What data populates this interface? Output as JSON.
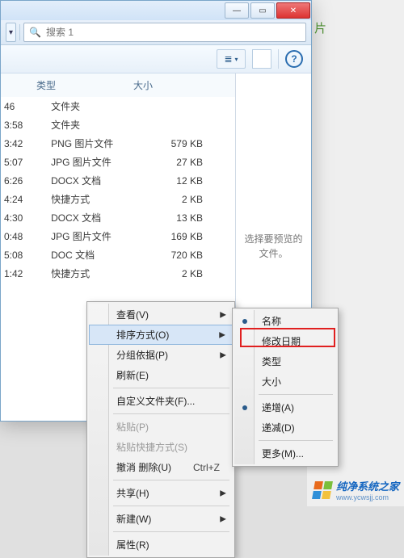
{
  "colors": {
    "accent": "#2a6db0",
    "danger": "#d33434",
    "highlight": "#e02020"
  },
  "titlebar": {
    "minimize": "—",
    "maximize": "▭",
    "close": "✕"
  },
  "corner_char": "片",
  "toolbar": {
    "nav_dropdown": "▾",
    "search_label": "搜索 1",
    "view_icon": "≣",
    "view_chevron": "▾",
    "preview_box": "□",
    "help": "?"
  },
  "columns": {
    "type": "类型",
    "size": "大小"
  },
  "rows": [
    {
      "time": "46",
      "type": "文件夹",
      "size": ""
    },
    {
      "time": "3:58",
      "type": "文件夹",
      "size": ""
    },
    {
      "time": "3:42",
      "type": "PNG 图片文件",
      "size": "579 KB"
    },
    {
      "time": "5:07",
      "type": "JPG 图片文件",
      "size": "27 KB"
    },
    {
      "time": "6:26",
      "type": "DOCX 文档",
      "size": "12 KB"
    },
    {
      "time": "4:24",
      "type": "快捷方式",
      "size": "2 KB"
    },
    {
      "time": "4:30",
      "type": "DOCX 文档",
      "size": "13 KB"
    },
    {
      "time": "0:48",
      "type": "JPG 图片文件",
      "size": "169 KB"
    },
    {
      "time": "5:08",
      "type": "DOC 文档",
      "size": "720 KB"
    },
    {
      "time": "1:42",
      "type": "快捷方式",
      "size": "2 KB"
    }
  ],
  "preview_text": "选择要预览的文件。",
  "context_menu": {
    "items": [
      {
        "label": "查看(V)",
        "submenu": true
      },
      {
        "label": "排序方式(O)",
        "submenu": true,
        "hover": true
      },
      {
        "label": "分组依据(P)",
        "submenu": true
      },
      {
        "label": "刷新(E)"
      },
      {
        "sep": true
      },
      {
        "label": "自定义文件夹(F)..."
      },
      {
        "sep": true
      },
      {
        "label": "粘贴(P)",
        "disabled": true
      },
      {
        "label": "粘贴快捷方式(S)",
        "disabled": true
      },
      {
        "label": "撤消 删除(U)",
        "shortcut": "Ctrl+Z"
      },
      {
        "sep": true
      },
      {
        "label": "共享(H)",
        "submenu": true
      },
      {
        "sep": true
      },
      {
        "label": "新建(W)",
        "submenu": true
      },
      {
        "sep": true
      },
      {
        "label": "属性(R)"
      }
    ]
  },
  "sort_submenu": {
    "items": [
      {
        "label": "名称",
        "checked": true
      },
      {
        "label": "修改日期",
        "highlight": true
      },
      {
        "label": "类型"
      },
      {
        "label": "大小"
      },
      {
        "sep": true
      },
      {
        "label": "递增(A)",
        "checked": true
      },
      {
        "label": "递减(D)"
      },
      {
        "sep": true
      },
      {
        "label": "更多(M)..."
      }
    ]
  },
  "watermark": {
    "text": "纯净系统之家",
    "url": "www.ycwsjj.com"
  }
}
